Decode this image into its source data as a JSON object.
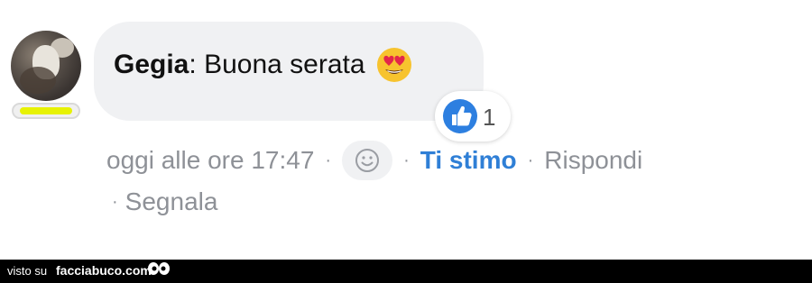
{
  "comment": {
    "author": "Gegia",
    "separator": ":",
    "message": "Buona serata",
    "emoji": "heart-eyes-emoji",
    "reaction": {
      "icon": "like-thumb-icon",
      "count": "1"
    }
  },
  "actions": {
    "timestamp": "oggi alle ore 17:47",
    "dot": "·",
    "react_icon": "smiley-icon",
    "like_label": "Ti stimo",
    "reply_label": "Rispondi",
    "report_label": "Segnala"
  },
  "badge": {
    "color": "#e7f204"
  },
  "footer": {
    "prefix": "visto su",
    "site": "facciabuco.com",
    "logo": "eyes-logo"
  },
  "colors": {
    "bubble": "#f0f1f3",
    "link_blue": "#2f7fd6",
    "muted": "#8e9197"
  }
}
